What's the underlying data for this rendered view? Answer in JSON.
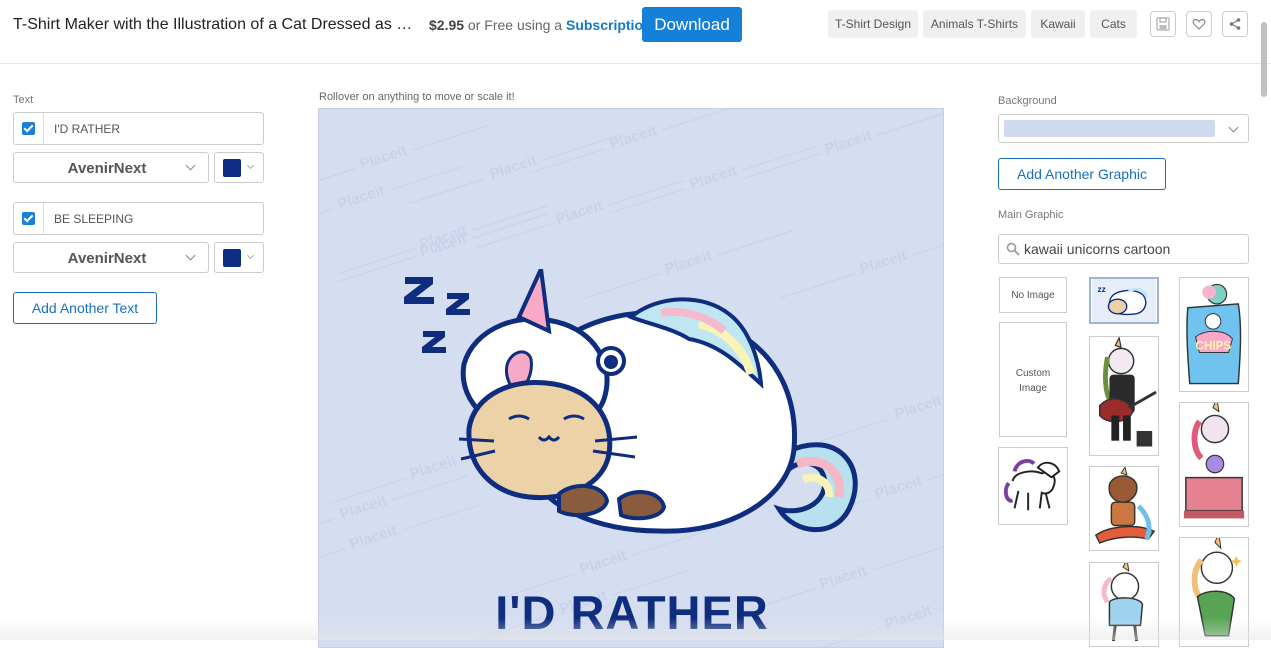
{
  "header": {
    "title": "T-Shirt Maker with the Illustration of a Cat Dressed as a Un…",
    "price": "$2.95",
    "price_suffix": " or Free using a ",
    "subscription_link": "Subscription",
    "download_label": "Download",
    "tags": [
      "T-Shirt Design",
      "Animals T-Shirts",
      "Kawaii",
      "Cats"
    ],
    "icons": [
      "save-icon",
      "heart-icon",
      "share-icon"
    ]
  },
  "text_panel": {
    "section_label": "Text",
    "lines": [
      {
        "enabled": true,
        "value": "I'D RATHER",
        "font": "AvenirNext",
        "color": "#0d2d82"
      },
      {
        "enabled": true,
        "value": "BE SLEEPING",
        "font": "AvenirNext",
        "color": "#0d2d82"
      }
    ],
    "add_text_label": "Add Another Text"
  },
  "canvas": {
    "hint": "Rollover on anything to move or scale it!",
    "background_color": "#d5ddf1",
    "watermark": "Placeit",
    "visible_text": "I'D RATHER",
    "text_color": "#0e2d7e",
    "zzz_icon": "zzz-icon"
  },
  "graphics_panel": {
    "background_label": "Background",
    "background_color": "#cfdaf0",
    "add_graphic_label": "Add Another Graphic",
    "main_graphic_label": "Main Graphic",
    "search_value": "kawaii unicorns cartoon",
    "no_image_label": "No Image",
    "custom_image_label": "Custom Image",
    "thumbnails": [
      "sleeping-cat-unicorn-thumb",
      "unicorn-chips-bag-thumb",
      "unicorn-guitar-rocker-thumb",
      "unicorn-fortune-teller-thumb",
      "walking-unicorn-thumb",
      "horse-surfer-thumb",
      "unicorn-in-shirt-thumb",
      "unicorn-mermaid-thumb"
    ]
  }
}
